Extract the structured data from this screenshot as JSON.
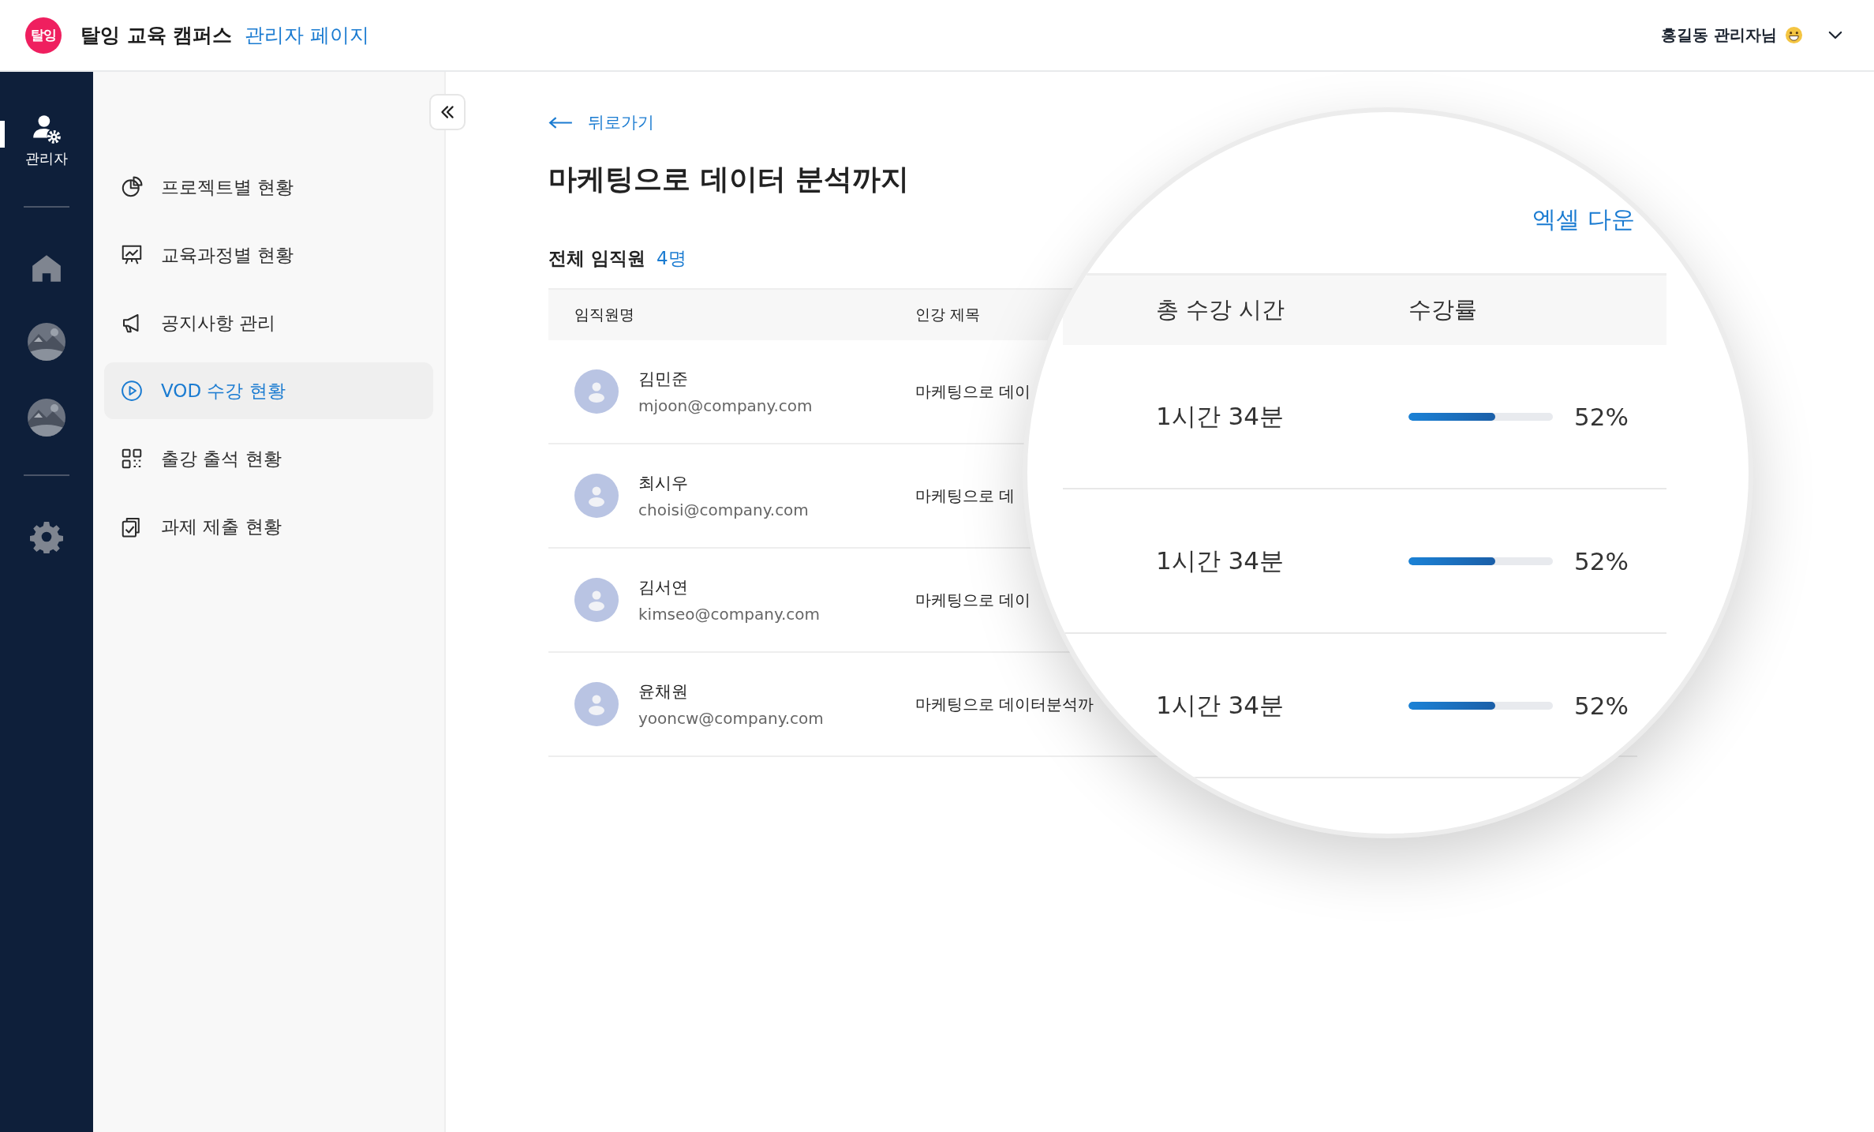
{
  "header": {
    "logo_text": "탈잉",
    "title": "탈잉 교육 캠퍼스",
    "subtitle": "관리자 페이지",
    "user": "홍길동 관리자님"
  },
  "rail": {
    "items": [
      {
        "kind": "admin",
        "label": "관리자",
        "selected": true
      },
      {
        "kind": "divider"
      },
      {
        "kind": "home",
        "selected": false
      },
      {
        "kind": "picture"
      },
      {
        "kind": "picture"
      },
      {
        "kind": "divider"
      },
      {
        "kind": "settings",
        "selected": false
      }
    ]
  },
  "sidebar": {
    "items": [
      {
        "kind": "pie",
        "label": "프로젝트별 현황",
        "selected": false
      },
      {
        "kind": "chart",
        "label": "교육과정별 현황",
        "selected": false
      },
      {
        "kind": "megaphone",
        "label": "공지사항 관리",
        "selected": false
      },
      {
        "kind": "play",
        "label": "VOD 수강 현황",
        "selected": true
      },
      {
        "kind": "qr",
        "label": "출강 출석 현황",
        "selected": false
      },
      {
        "kind": "clipboard",
        "label": "과제 제출 현황",
        "selected": false
      }
    ]
  },
  "main": {
    "back": "뒤로가기",
    "title": "마케팅으로 데이터 분석까지",
    "count_label": "전체 임직원",
    "count": "4명",
    "table": {
      "columns": [
        "임직원명",
        "인강 제목"
      ],
      "rows": [
        {
          "name": "김민준",
          "email": "mjoon@company.com",
          "course": "마케팅으로 데이"
        },
        {
          "name": "최시우",
          "email": "choisi@company.com",
          "course": "마케팅으로 데"
        },
        {
          "name": "김서연",
          "email": "kimseo@company.com",
          "course": "마케팅으로 데이"
        },
        {
          "name": "윤채원",
          "email": "yooncw@company.com",
          "course": "마케팅으로 데이터분석까"
        }
      ]
    }
  },
  "magnifier": {
    "action": "엑셀 다운",
    "columns": [
      "총 수강 시간",
      "수강률"
    ],
    "rows": [
      {
        "time": "1시간 34분",
        "level": 0.6,
        "percent": "52%"
      },
      {
        "time": "1시간 34분",
        "level": 0.6,
        "percent": "52%"
      },
      {
        "time": "1시간 34분",
        "level": 0.6,
        "percent": "52%"
      }
    ]
  }
}
